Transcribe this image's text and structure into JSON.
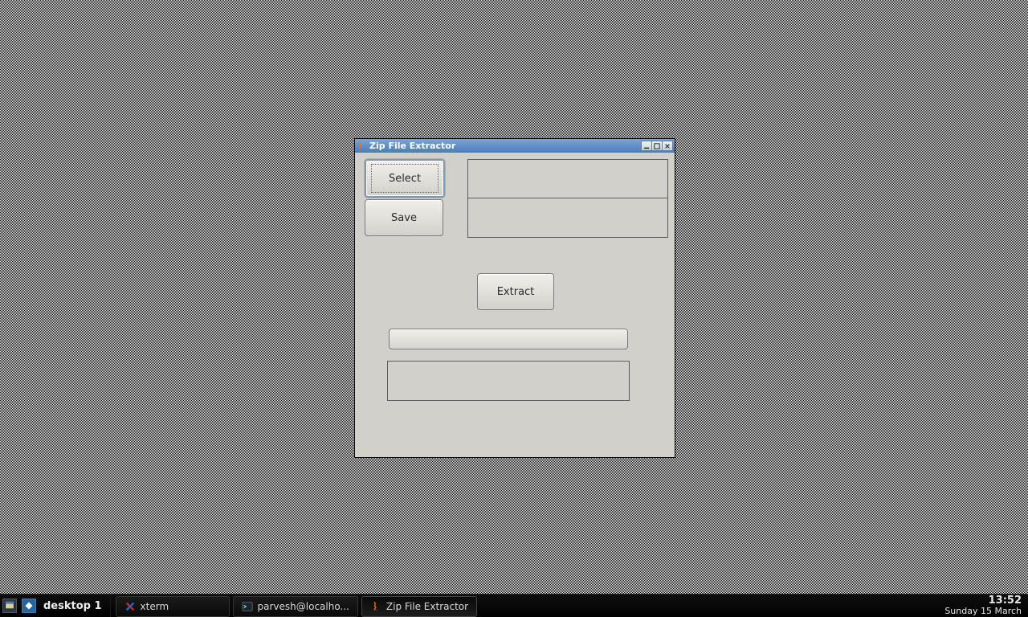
{
  "taskbar": {
    "pager_label": "desktop 1",
    "items": [
      {
        "label": "xterm",
        "icon": "x-icon"
      },
      {
        "label": "parvesh@localho...",
        "icon": "terminal-icon"
      },
      {
        "label": "Zip File Extractor",
        "icon": "java-icon",
        "active": true
      }
    ],
    "clock": {
      "time": "13:52",
      "date": "Sunday 15 March"
    }
  },
  "window": {
    "title": "Zip File Extractor",
    "buttons": {
      "select": "Select",
      "save": "Save",
      "extract": "Extract"
    },
    "fields": {
      "source_path": "",
      "dest_path": "",
      "status": ""
    }
  }
}
